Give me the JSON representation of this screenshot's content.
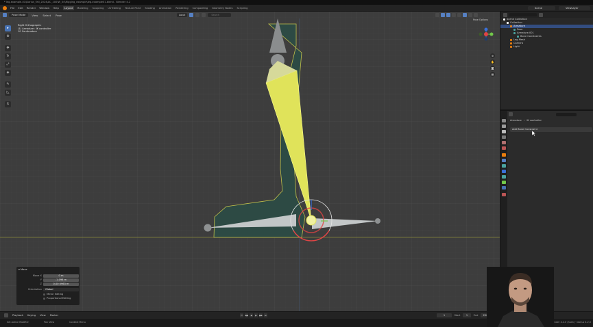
{
  "window_title": "* leg-example-01\\Darius_Fall_2024\\AC_200\\W_04\\Rigging_example\\leg-example01.blend - Blender 4.2",
  "menu": [
    "File",
    "Edit",
    "Render",
    "Window",
    "Help"
  ],
  "workspace_tabs": [
    "Layout",
    "Modeling",
    "Sculpting",
    "UV Editing",
    "Texture Paint",
    "Shading",
    "Animation",
    "Rendering",
    "Compositing",
    "Geometry Nodes",
    "Scripting"
  ],
  "active_tab": "Layout",
  "scene_name": "Scene",
  "view_layer": "ViewLayer",
  "viewport": {
    "mode": "Pose Mode",
    "header_menus": [
      "View",
      "Select",
      "Pose"
    ],
    "transform_orientation": "Local",
    "search_placeholder": "Search",
    "overlay_lines": [
      "Right Orthographic",
      "(1) Armature : IK controller",
      "10 Centimeters"
    ],
    "pose_options": "Pose Options"
  },
  "operator_panel": {
    "title": "Move",
    "move_x_label": "Move X",
    "move_x_value": "0 m",
    "y_label": "Y",
    "y_value": "-1.098 m",
    "z_label": "Z",
    "z_value": "0.00 0963 m",
    "orientation_label": "Orientation",
    "orientation_value": "Global",
    "mirror_editing": "Mirror Editing",
    "proportional_editing": "Proportional Editing"
  },
  "outliner": {
    "items": [
      {
        "label": "Scene Collection",
        "indent": 0,
        "dot": "#ffffff"
      },
      {
        "label": "Collection",
        "indent": 1,
        "dot": "#ffffff"
      },
      {
        "label": "Armature",
        "indent": 2,
        "dot": "#e87d0d",
        "selected": true
      },
      {
        "label": "Pose",
        "indent": 3,
        "dot": "#4aa3a0"
      },
      {
        "label": "Armature.001",
        "indent": 3,
        "dot": "#4aa3a0"
      },
      {
        "label": "Bone Constraints",
        "indent": 4,
        "dot": "#4aa3a0"
      },
      {
        "label": "Leg.Mesh",
        "indent": 2,
        "dot": "#e87d0d"
      },
      {
        "label": "Camera",
        "indent": 2,
        "dot": "#e87d0d"
      },
      {
        "label": "Light",
        "indent": 2,
        "dot": "#e87d0d"
      }
    ]
  },
  "properties": {
    "breadcrumb_armature": "Armature",
    "breadcrumb_bone": "IK controller",
    "add_bone_constraint": "Add Bone Constraint"
  },
  "timeline": {
    "menus": [
      "Playback",
      "Keying",
      "View",
      "Marker"
    ],
    "current_frame": "1",
    "start_label": "Start",
    "start_value": "1",
    "end_label": "End",
    "end_value": "250"
  },
  "statusbar": {
    "items": [
      "Set Active Modifier",
      "Pan View",
      "Context Menu"
    ],
    "version": "Blender 4.2.0 (hash) · Darius 4.2.0"
  },
  "colors": {
    "accent": "#4772b3",
    "bone_selected": "#e0e35a",
    "mesh_rim": "#c3c24b",
    "mesh_fill": "#2d4a44",
    "selection_circle": "#f27a7a"
  }
}
